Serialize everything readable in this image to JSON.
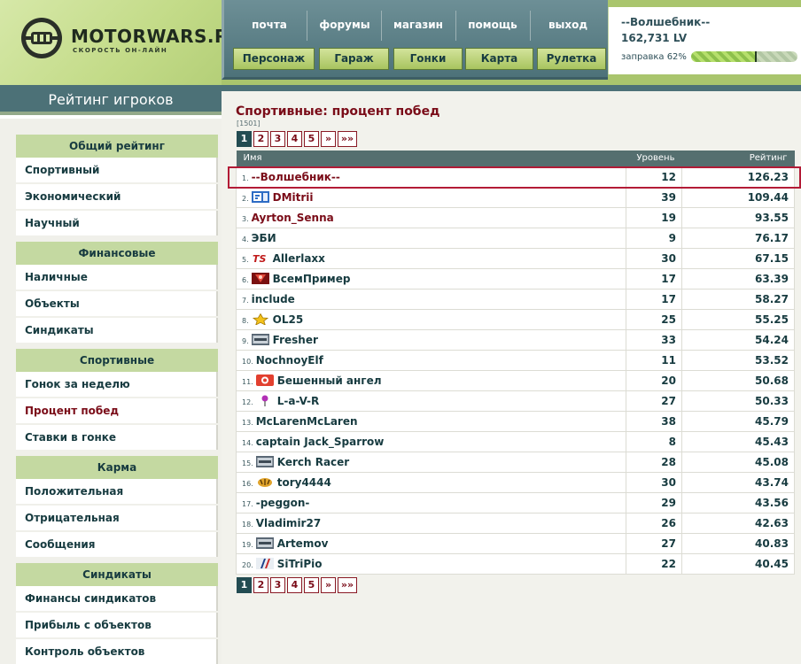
{
  "logo": {
    "title": "MOTORWARS.RU",
    "subtitle": "СКОРОСТЬ ОН-ЛАЙН"
  },
  "nav": {
    "top_links": [
      "почта",
      "форумы",
      "магазин",
      "помощь",
      "выход"
    ],
    "buttons": [
      "Персонаж",
      "Гараж",
      "Гонки",
      "Карта",
      "Рулетка"
    ]
  },
  "user": {
    "name": "--Волшебник--",
    "money": "162,731 LV",
    "fuel_label": "заправка 62%",
    "fuel_percent": 62
  },
  "sidebar": {
    "title": "Рейтинг игроков",
    "groups": [
      {
        "label": "Общий рейтинг",
        "items": [
          "Спортивный",
          "Экономический",
          "Научный"
        ]
      },
      {
        "label": "Финансовые",
        "items": [
          "Наличные",
          "Объекты",
          "Синдикаты"
        ]
      },
      {
        "label": "Спортивные",
        "items": [
          "Гонок за неделю",
          "Процент побед",
          "Ставки в гонке"
        ]
      },
      {
        "label": "Карма",
        "items": [
          "Положительная",
          "Отрицательная",
          "Сообщения"
        ]
      },
      {
        "label": "Синдикаты",
        "items": [
          "Финансы синдикатов",
          "Прибыль с объектов",
          "Контроль объектов"
        ]
      }
    ],
    "active_item": "Процент побед"
  },
  "main": {
    "title": "Спортивные: процент побед",
    "total": "[1501]",
    "pager": [
      "1",
      "2",
      "3",
      "4",
      "5",
      "»",
      "»»"
    ],
    "current_page": "1",
    "columns": {
      "name": "Имя",
      "level": "Уровень",
      "rating": "Рейтинг"
    },
    "rows": [
      {
        "rank": "1.",
        "name": "--Волшебник--",
        "level": "12",
        "rating": "126.23",
        "badge": "",
        "color": "maroon"
      },
      {
        "rank": "2.",
        "name": "DMitrii",
        "level": "39",
        "rating": "109.44",
        "badge": "flag-blue-badge",
        "color": "maroon"
      },
      {
        "rank": "3.",
        "name": "Ayrton_Senna",
        "level": "19",
        "rating": "93.55",
        "badge": "",
        "color": "maroon"
      },
      {
        "rank": "4.",
        "name": "ЭБИ",
        "level": "9",
        "rating": "76.17",
        "badge": "",
        "color": "teal"
      },
      {
        "rank": "5.",
        "name": "Allerlaxx",
        "level": "30",
        "rating": "67.15",
        "badge": "ts-logo-badge",
        "color": "teal"
      },
      {
        "rank": "6.",
        "name": "ВсемПример",
        "level": "17",
        "rating": "63.39",
        "badge": "red-emblem-badge",
        "color": "teal"
      },
      {
        "rank": "7.",
        "name": "include",
        "level": "17",
        "rating": "58.27",
        "badge": "",
        "color": "teal"
      },
      {
        "rank": "8.",
        "name": "OL25",
        "level": "25",
        "rating": "55.25",
        "badge": "star-badge",
        "color": "teal"
      },
      {
        "rank": "9.",
        "name": "Fresher",
        "level": "33",
        "rating": "54.24",
        "badge": "grey-plate-badge",
        "color": "teal"
      },
      {
        "rank": "10.",
        "name": "NochnoyElf",
        "level": "11",
        "rating": "53.52",
        "badge": "",
        "color": "teal"
      },
      {
        "rank": "11.",
        "name": "Бешенный ангел",
        "level": "20",
        "rating": "50.68",
        "badge": "red-circle-badge",
        "color": "teal"
      },
      {
        "rank": "12.",
        "name": "L-a-V-R",
        "level": "27",
        "rating": "50.33",
        "badge": "pin-badge",
        "color": "teal"
      },
      {
        "rank": "13.",
        "name": "McLarenMcLaren",
        "level": "38",
        "rating": "45.79",
        "badge": "",
        "color": "teal"
      },
      {
        "rank": "14.",
        "name": "captain Jack_Sparrow",
        "level": "8",
        "rating": "45.43",
        "badge": "",
        "color": "teal"
      },
      {
        "rank": "15.",
        "name": "Kerch Racer",
        "level": "28",
        "rating": "45.08",
        "badge": "grey-plate-badge",
        "color": "teal"
      },
      {
        "rank": "16.",
        "name": "tory4444",
        "level": "30",
        "rating": "43.74",
        "badge": "tiger-badge",
        "color": "teal"
      },
      {
        "rank": "17.",
        "name": "-peggon-",
        "level": "29",
        "rating": "43.56",
        "badge": "",
        "color": "teal"
      },
      {
        "rank": "18.",
        "name": "Vladimir27",
        "level": "26",
        "rating": "42.63",
        "badge": "",
        "color": "teal"
      },
      {
        "rank": "19.",
        "name": "Artemov",
        "level": "27",
        "rating": "40.83",
        "badge": "grey-plate-badge",
        "color": "teal"
      },
      {
        "rank": "20.",
        "name": "SiTriPio",
        "level": "22",
        "rating": "40.45",
        "badge": "slash-badge",
        "color": "teal"
      }
    ]
  },
  "colors": {
    "header_green": "#a9c56d",
    "nav_teal": "#4c7177",
    "accent_maroon": "#7a0c18",
    "highlight_border": "#b31b36",
    "group_green": "#c4d9a1"
  }
}
